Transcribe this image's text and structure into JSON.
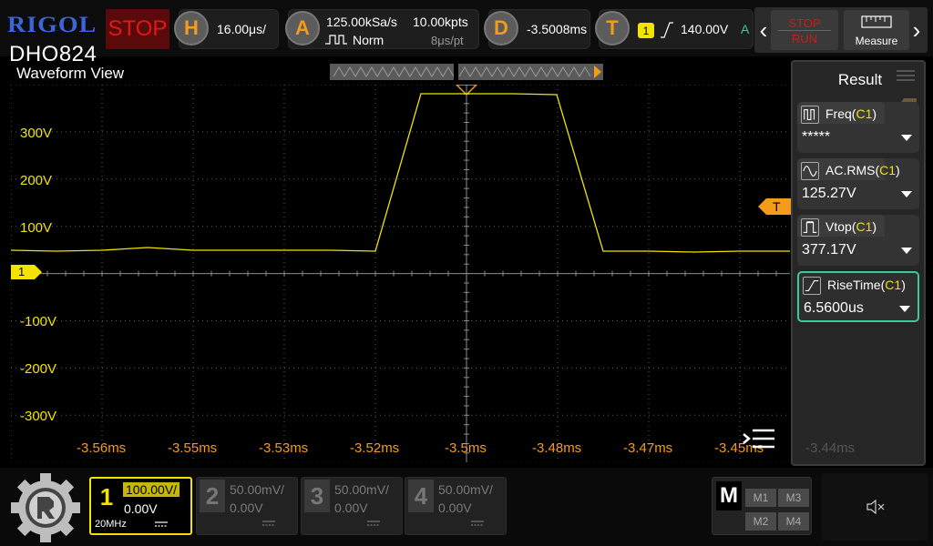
{
  "brand": {
    "logo": "RIGOL",
    "model": "DHO824"
  },
  "run_state": "STOP",
  "horizontal": {
    "key": "H",
    "timebase": "16.00μs/"
  },
  "acquire": {
    "key": "A",
    "sample_rate": "125.00kSa/s",
    "memory_depth": "10.00kpts",
    "mode": "Norm",
    "sample_interval": "8μs/pt"
  },
  "delay": {
    "key": "D",
    "value": "-3.5008ms"
  },
  "trigger": {
    "key": "T",
    "source": "1",
    "level": "140.00V",
    "sweep": "A",
    "marker": "T"
  },
  "controls": {
    "stop_label": "STOP",
    "run_label": "RUN",
    "measure_label": "Measure"
  },
  "waveform": {
    "title": "Waveform View",
    "channel_marker": "1",
    "y_labels": [
      "300V",
      "200V",
      "100V",
      "-100V",
      "-200V",
      "-300V"
    ],
    "x_labels": [
      "-3.56ms",
      "-3.55ms",
      "-3.53ms",
      "-3.52ms",
      "-3.5ms",
      "-3.48ms",
      "-3.47ms",
      "-3.45ms",
      "-3.44ms"
    ]
  },
  "result": {
    "title": "Result",
    "items": [
      {
        "name": "Freq",
        "channel": "C1",
        "value": "*****",
        "icon": "frequency-icon",
        "active": false
      },
      {
        "name": "AC.RMS",
        "channel": "C1",
        "value": "125.27V",
        "icon": "sine-wave-icon",
        "active": false
      },
      {
        "name": "Vtop",
        "channel": "C1",
        "value": "377.17V",
        "icon": "pulse-top-icon",
        "active": false
      },
      {
        "name": "RiseTime",
        "channel": "C1",
        "value": "6.5600us",
        "icon": "rising-edge-icon",
        "active": true
      }
    ]
  },
  "channels": [
    {
      "num": "1",
      "scale": "100.00V/",
      "offset": "0.00V",
      "bw": "20MHz",
      "active": true
    },
    {
      "num": "2",
      "scale": "50.00mV/",
      "offset": "0.00V",
      "active": false
    },
    {
      "num": "3",
      "scale": "50.00mV/",
      "offset": "0.00V",
      "active": false
    },
    {
      "num": "4",
      "scale": "50.00mV/",
      "offset": "0.00V",
      "active": false
    }
  ],
  "math": {
    "label": "M",
    "items": [
      "M1",
      "M3",
      "M2",
      "M4"
    ]
  },
  "colors": {
    "ch1": "#f2e300",
    "accent": "#f49b1a",
    "stop": "#e01818",
    "active_border": "#3fc79c"
  }
}
